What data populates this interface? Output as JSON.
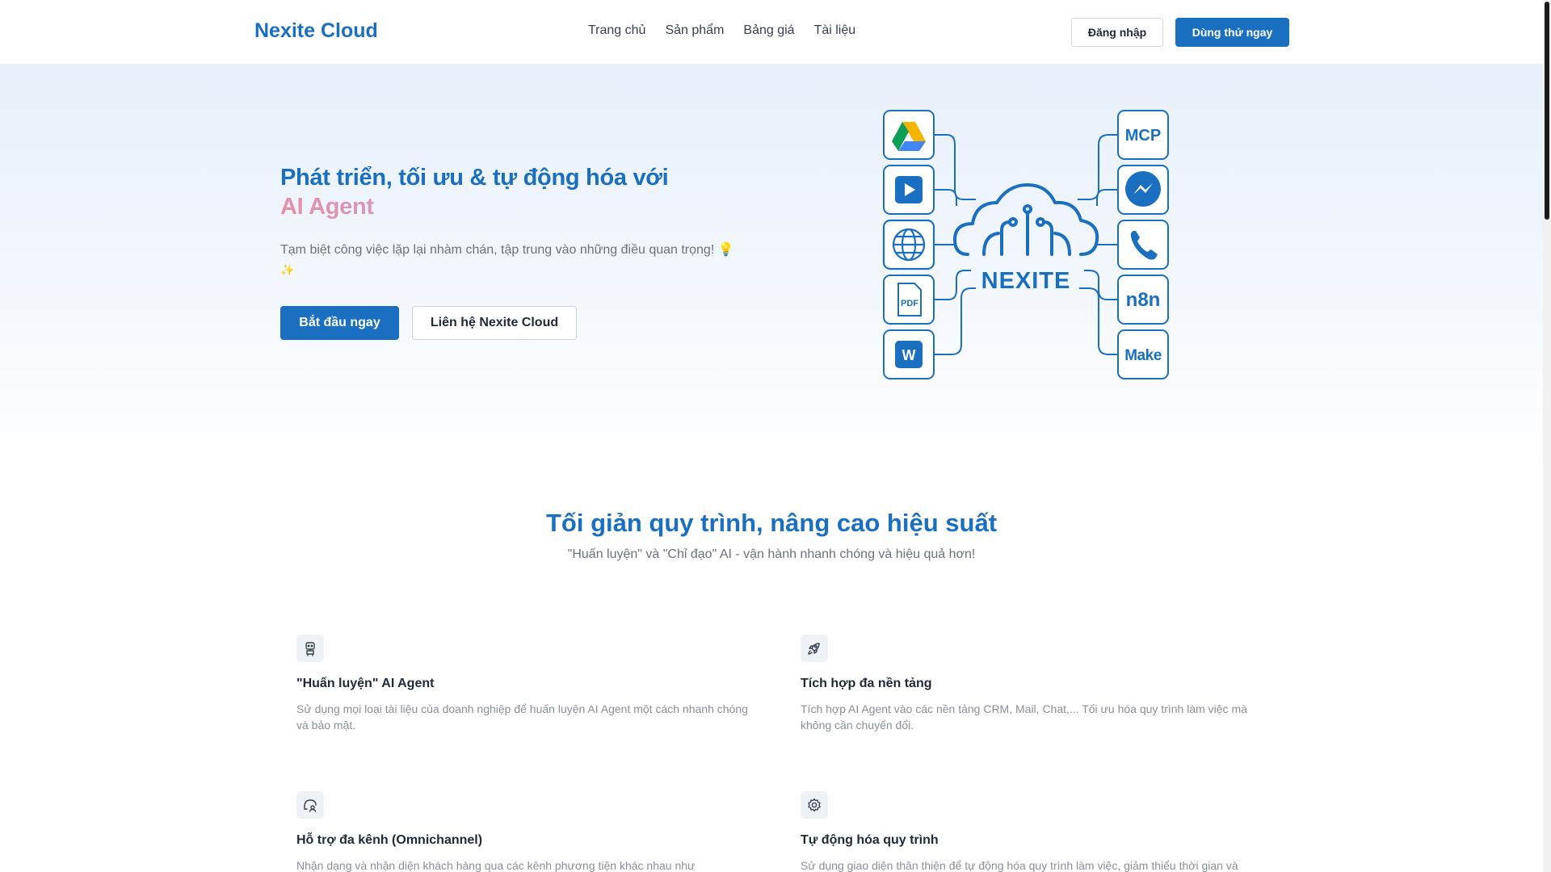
{
  "header": {
    "logo": "Nexite Cloud",
    "nav": [
      "Trang chủ",
      "Sản phẩm",
      "Bảng giá",
      "Tài liệu"
    ],
    "login_label": "Đăng nhập",
    "trial_label": "Dùng thử ngay"
  },
  "hero": {
    "title": "Phát triển, tối ưu & tự động hóa với",
    "title_accent": "AI Agent",
    "subtitle": "Tạm biệt công việc lặp lại nhàm chán, tập trung vào những điều quan trọng!",
    "start_label": "Bắt đầu ngay",
    "contact_label": "Liên hệ Nexite Cloud",
    "diagram": {
      "brand": "NEXITE",
      "right_labels": {
        "mcp": "MCP",
        "n8n": "n8n",
        "make": "Make"
      },
      "left_labels": {
        "pdf": "PDF",
        "word": "W"
      },
      "icons": [
        "google-drive-icon",
        "video-play-icon",
        "globe-icon",
        "pdf-icon",
        "word-icon",
        "mcp-icon",
        "messenger-icon",
        "phone-icon",
        "n8n-icon",
        "make-icon"
      ],
      "line_color": "#1a6fc0"
    }
  },
  "section": {
    "title": "Tối giản quy trình, nâng cao hiệu suất",
    "subtitle": "\"Huấn luyện\" và \"Chỉ đạo\" AI - vận hành nhanh chóng và hiệu quả hơn!"
  },
  "features": [
    {
      "icon": "robot-icon",
      "title": "\"Huấn luyện\" AI Agent",
      "desc": "Sử dụng mọi loại tài liệu của doanh nghiệp để huấn luyện AI Agent một cách nhanh chóng và bảo mật."
    },
    {
      "icon": "rocket-icon",
      "title": "Tích hợp đa nền tảng",
      "desc": "Tích hợp AI Agent vào các nền tảng CRM, Mail, Chat,... Tối ưu hóa quy trình làm việc mà không cần chuyển đổi."
    },
    {
      "icon": "chat-user-icon",
      "title": "Hỗ trợ đa kênh (Omnichannel)",
      "desc": "Nhận dạng và nhận diện khách hàng qua các kênh phương tiện khác nhau như"
    },
    {
      "icon": "gear-icon",
      "title": "Tự động hóa quy trình",
      "desc": "Sử dụng giao diện thân thiện để tự động hóa quy trình làm việc, giảm thiểu thời gian và"
    }
  ],
  "colors": {
    "brand": "#1a6fc0",
    "text": "#1f2937",
    "muted": "#6b7280"
  }
}
